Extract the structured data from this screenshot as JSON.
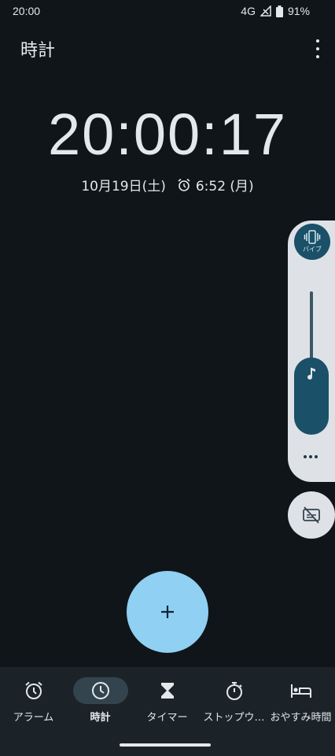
{
  "status_bar": {
    "time": "20:00",
    "network": "4G",
    "battery": "91%"
  },
  "header": {
    "title": "時計"
  },
  "clock": {
    "time": "20:00:17",
    "date": "10月19日(土)",
    "next_alarm": "6:52 (月)"
  },
  "volume_panel": {
    "vibrate_label": "バイブ",
    "music_level": 0.55
  },
  "fab": {
    "icon": "plus-icon"
  },
  "nav": {
    "items": [
      {
        "label": "アラーム",
        "icon": "alarm-icon"
      },
      {
        "label": "時計",
        "icon": "clock-icon",
        "active": true
      },
      {
        "label": "タイマー",
        "icon": "hourglass-icon"
      },
      {
        "label": "ストップウ…",
        "icon": "stopwatch-icon"
      },
      {
        "label": "おやすみ時間",
        "icon": "bed-icon"
      }
    ]
  },
  "colors": {
    "background": "#0f1519",
    "fab": "#8fd0f3",
    "accent": "#1a5068",
    "nav_bg": "#1b2328"
  }
}
